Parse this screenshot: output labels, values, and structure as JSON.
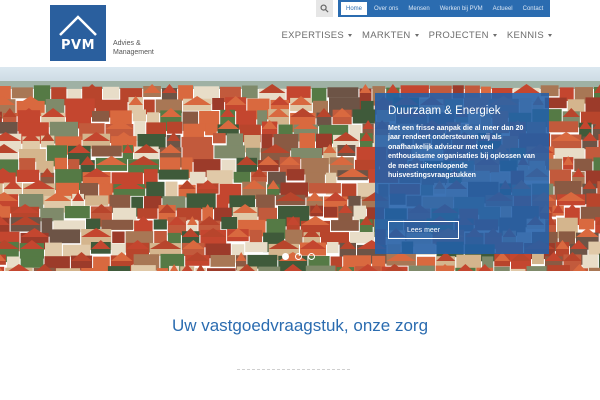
{
  "brand": {
    "logo_text": "PVM",
    "tagline_line1": "Advies &",
    "tagline_line2": "Management",
    "color": "#2a5f9e"
  },
  "topbar": {
    "search_icon": "search-icon",
    "items": [
      {
        "label": "Home",
        "active": true
      },
      {
        "label": "Over ons",
        "active": false
      },
      {
        "label": "Mensen",
        "active": false
      },
      {
        "label": "Werken bij PVM",
        "active": false
      },
      {
        "label": "Actueel",
        "active": false
      },
      {
        "label": "Contact",
        "active": false
      }
    ],
    "color": "#2b6cb0"
  },
  "mainnav": {
    "items": [
      {
        "label": "EXPERTISES"
      },
      {
        "label": "MARKTEN"
      },
      {
        "label": "PROJECTEN"
      },
      {
        "label": "KENNIS"
      }
    ]
  },
  "hero": {
    "title": "Duurzaam & Energiek",
    "text": "Met een frisse aanpak die al meer dan 20 jaar rendeert ondersteunen wij als onafhankelijk adviseur met veel enthousiasme organisaties bij oplossen van de meest uiteenlopende huisvestingsvraagstukken",
    "button_label": "Lees meer",
    "slides": 3,
    "active_slide": 1
  },
  "content": {
    "slogan": "Uw vastgoedvraagstuk, onze zorg"
  }
}
